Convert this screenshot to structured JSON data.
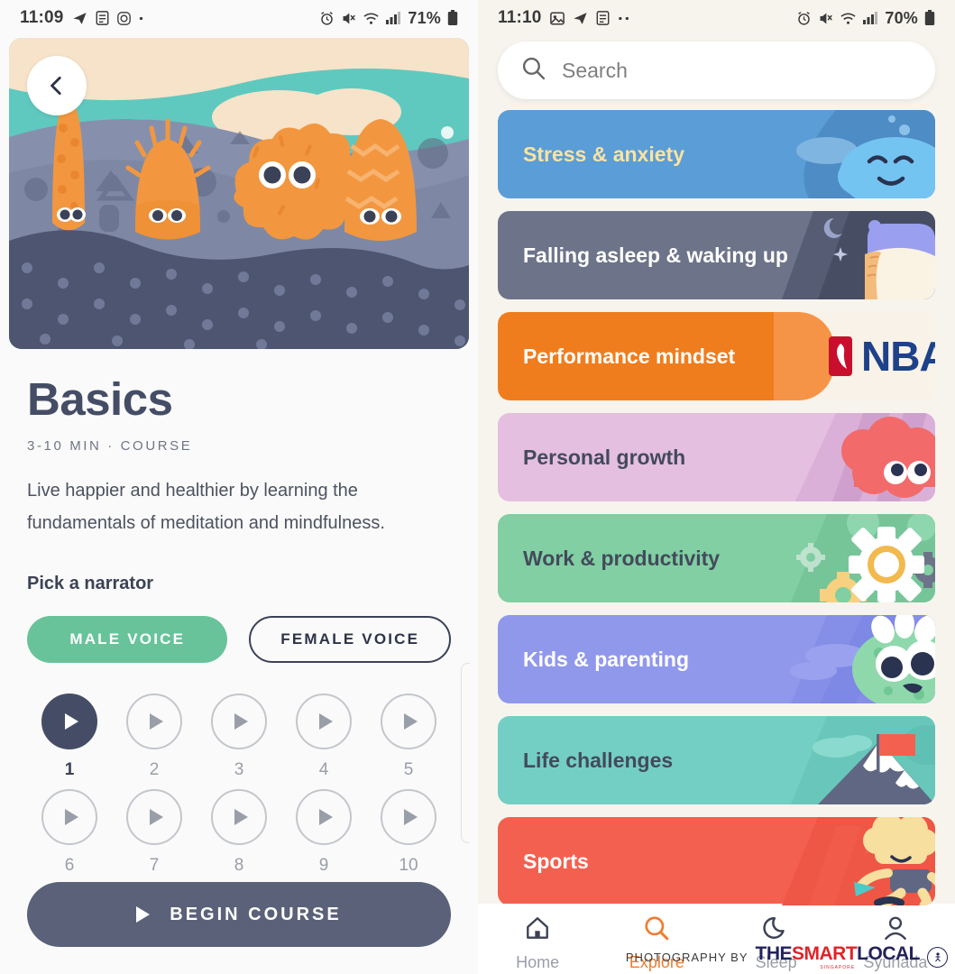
{
  "left_screen": {
    "status_bar": {
      "time": "11:09",
      "battery": "71%",
      "left_icons": [
        "telegram-icon",
        "notes-icon",
        "instagram-icon",
        "dot-icon"
      ],
      "right_icons": [
        "alarm-icon",
        "mute-icon",
        "wifi-icon",
        "signal-icon",
        "battery-icon"
      ]
    },
    "back_button_icon": "chevron-left-icon",
    "hero_alt": "underwater coral characters illustration",
    "title": "Basics",
    "meta": "3-10 MIN · COURSE",
    "description": "Live happier and healthier by learning the fundamentals of meditation and mindfulness.",
    "narrator_label": "Pick a narrator",
    "narrators": [
      {
        "label": "MALE VOICE",
        "selected": true
      },
      {
        "label": "FEMALE VOICE",
        "selected": false
      }
    ],
    "episodes": [
      {
        "number": "1",
        "state": "current"
      },
      {
        "number": "2",
        "state": "locked"
      },
      {
        "number": "3",
        "state": "locked"
      },
      {
        "number": "4",
        "state": "locked"
      },
      {
        "number": "5",
        "state": "locked"
      },
      {
        "number": "6",
        "state": "locked"
      },
      {
        "number": "7",
        "state": "locked"
      },
      {
        "number": "8",
        "state": "locked"
      },
      {
        "number": "9",
        "state": "locked"
      },
      {
        "number": "10",
        "state": "locked"
      }
    ],
    "begin_button": "BEGIN COURSE",
    "colors": {
      "accent_green": "#68c39a",
      "navy": "#454d66",
      "button_slate": "#5a6179"
    }
  },
  "right_screen": {
    "status_bar": {
      "time": "11:10",
      "battery": "70%",
      "left_icons": [
        "image-icon",
        "telegram-icon",
        "notes-icon",
        "more-dots-icon"
      ],
      "right_icons": [
        "alarm-icon",
        "mute-icon",
        "wifi-icon",
        "signal-icon",
        "battery-icon"
      ]
    },
    "search": {
      "placeholder": "Search",
      "icon": "search-icon"
    },
    "categories": [
      {
        "label": "Stress & anxiety",
        "bg": "#5b9dd6",
        "text": "#fbe3a1",
        "art": "cloud-face"
      },
      {
        "label": "Falling asleep & waking up",
        "bg": "#6d7489",
        "text": "#ffffff",
        "art": "moon-pillow"
      },
      {
        "label": "Performance mindset",
        "bg": "#f07d1d",
        "text": "#ffffff",
        "art": "nba-logo"
      },
      {
        "label": "Personal growth",
        "bg": "#e4bfe0",
        "text": "#434a5c",
        "art": "brain-face"
      },
      {
        "label": "Work & productivity",
        "bg": "#81cfa2",
        "text": "#434a5c",
        "art": "gears"
      },
      {
        "label": "Kids & parenting",
        "bg": "#9098ec",
        "text": "#ffffff",
        "art": "monster-face"
      },
      {
        "label": "Life challenges",
        "bg": "#73cfc3",
        "text": "#434a5c",
        "art": "mountain-flag"
      },
      {
        "label": "Sports",
        "bg": "#f4604f",
        "text": "#ffffff",
        "art": "runner"
      }
    ],
    "bottom_nav": [
      {
        "label": "Home",
        "icon": "home-icon",
        "active": false
      },
      {
        "label": "Explore",
        "icon": "search-icon",
        "active": true
      },
      {
        "label": "Sleep",
        "icon": "moon-icon",
        "active": false
      },
      {
        "label": "Syuhada",
        "icon": "person-icon",
        "active": false
      }
    ],
    "active_nav_color": "#ee7d30"
  },
  "watermark": {
    "prefix": "PHOTOGRAPHY BY",
    "brand_1": "THE",
    "brand_2": "SMART",
    "brand_3": "LOCAL",
    "sub": "SINGAPORE"
  }
}
